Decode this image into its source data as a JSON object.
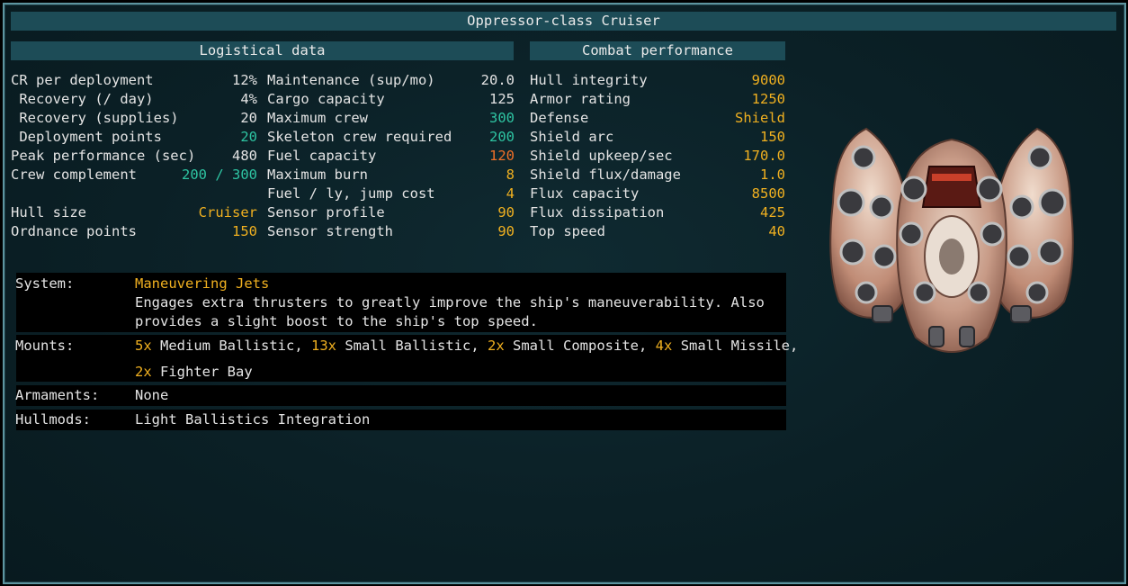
{
  "title": "Oppressor-class Cruiser",
  "logistical": {
    "header": "Logistical data",
    "col1": [
      {
        "label": "CR per deployment",
        "value": "12%",
        "color": "w"
      },
      {
        "label": " Recovery (/ day)",
        "value": "4%",
        "color": "w"
      },
      {
        "label": " Recovery (supplies)",
        "value": "20",
        "color": "w"
      },
      {
        "label": " Deployment points",
        "value": "20",
        "color": "g"
      },
      {
        "label": "Peak performance (sec)",
        "value": "480",
        "color": "w"
      },
      {
        "label": "Crew complement",
        "value": "200 / 300",
        "color": "g"
      },
      {
        "label": "",
        "value": "",
        "color": "w"
      },
      {
        "label": "Hull size",
        "value": "Cruiser",
        "color": "y"
      },
      {
        "label": "Ordnance points",
        "value": "150",
        "color": "y"
      }
    ],
    "col2": [
      {
        "label": "Maintenance (sup/mo)",
        "value": "20.0",
        "color": "w"
      },
      {
        "label": "Cargo capacity",
        "value": "125",
        "color": "w"
      },
      {
        "label": "Maximum crew",
        "value": "300",
        "color": "g"
      },
      {
        "label": "Skeleton crew required",
        "value": "200",
        "color": "g"
      },
      {
        "label": "Fuel capacity",
        "value": "120",
        "color": "o"
      },
      {
        "label": "Maximum burn",
        "value": "8",
        "color": "y"
      },
      {
        "label": "Fuel / ly, jump cost",
        "value": "4",
        "color": "y"
      },
      {
        "label": "Sensor profile",
        "value": "90",
        "color": "y"
      },
      {
        "label": "Sensor strength",
        "value": "90",
        "color": "y"
      }
    ]
  },
  "combat": {
    "header": "Combat performance",
    "rows": [
      {
        "label": "Hull integrity",
        "value": "9000",
        "color": "y"
      },
      {
        "label": "Armor rating",
        "value": "1250",
        "color": "y"
      },
      {
        "label": "Defense",
        "value": "Shield",
        "color": "y"
      },
      {
        "label": "Shield arc",
        "value": "150",
        "color": "y"
      },
      {
        "label": "Shield upkeep/sec",
        "value": "170.0",
        "color": "y"
      },
      {
        "label": "Shield flux/damage",
        "value": "1.0",
        "color": "y"
      },
      {
        "label": "Flux capacity",
        "value": "8500",
        "color": "y"
      },
      {
        "label": "Flux dissipation",
        "value": "425",
        "color": "y"
      },
      {
        "label": "Top speed",
        "value": "40",
        "color": "y"
      }
    ]
  },
  "system": {
    "label": "System:",
    "name": "Maneuvering Jets",
    "desc1": "Engages extra thrusters to greatly improve the ship's maneuverability. Also",
    "desc2": "provides a slight boost to the ship's top speed."
  },
  "mounts": {
    "label": "Mounts:",
    "items": [
      {
        "count": "5x",
        "name": "Medium Ballistic",
        "sep": ", "
      },
      {
        "count": "13x",
        "name": "Small Ballistic",
        "sep": ", "
      },
      {
        "count": "2x",
        "name": "Small Composite",
        "sep": ", "
      },
      {
        "count": "4x",
        "name": "Small Missile",
        "sep": ","
      }
    ],
    "line2": {
      "count": "2x",
      "name": "Fighter Bay"
    }
  },
  "armaments": {
    "label": "Armaments:",
    "value": "None"
  },
  "hullmods": {
    "label": "Hullmods:",
    "value": "Light Ballistics Integration"
  },
  "colors": {
    "w": "#e4e4e4",
    "y": "#f0b020",
    "g": "#2ec4a2",
    "o": "#f07028",
    "header_bg": "#1d4c57",
    "frame": "#5d95a0"
  }
}
